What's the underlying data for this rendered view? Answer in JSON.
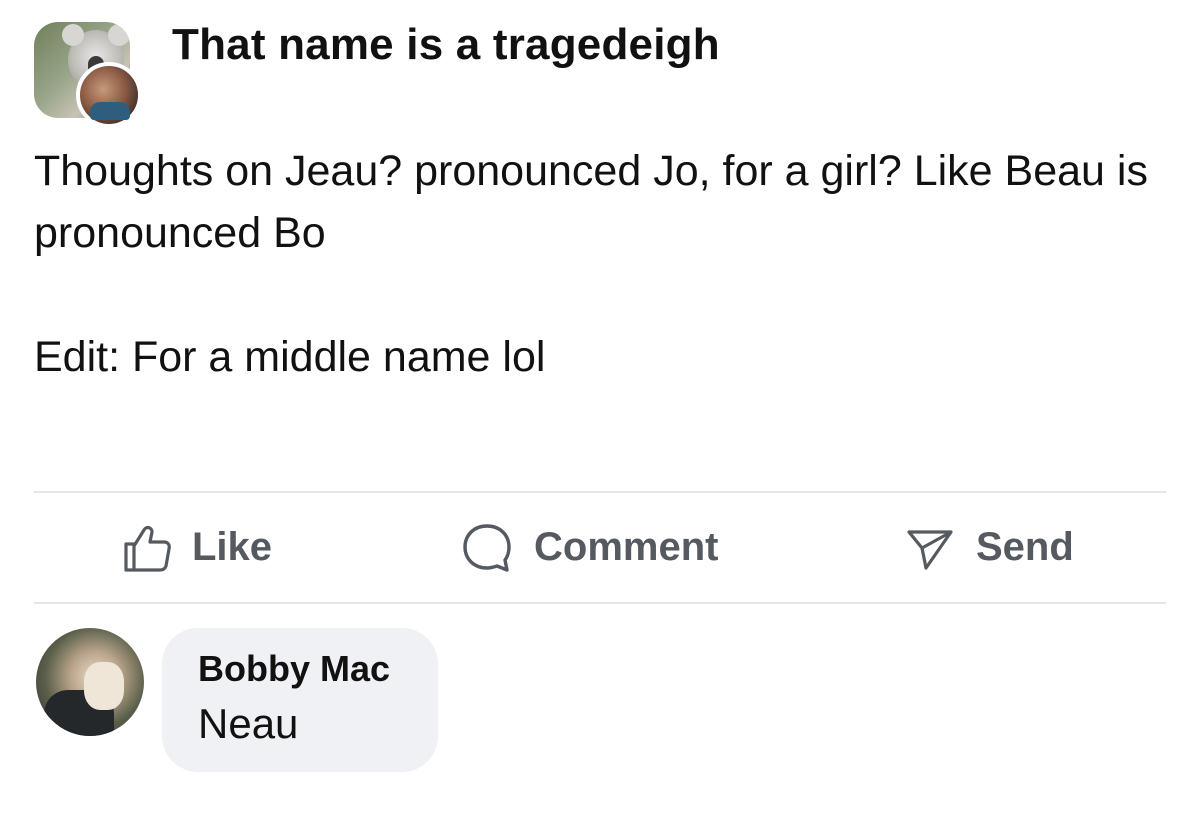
{
  "post": {
    "group_name": "That name is a tragedeigh",
    "body_line": "Thoughts on Jeau? pronounced Jo, for a girl? Like Beau is pronounced Bo",
    "edit_line": "Edit: For a middle name lol"
  },
  "actions": {
    "like_label": "Like",
    "comment_label": "Comment",
    "send_label": "Send"
  },
  "comment": {
    "author": "Bobby Mac",
    "text": "Neau"
  },
  "icons": {
    "like": "thumbs-up-icon",
    "comment": "speech-bubble-icon",
    "send": "send-icon"
  },
  "colors": {
    "action_text": "#555a61",
    "bubble_bg": "#f0f1f4",
    "divider": "#e4e6ea"
  }
}
